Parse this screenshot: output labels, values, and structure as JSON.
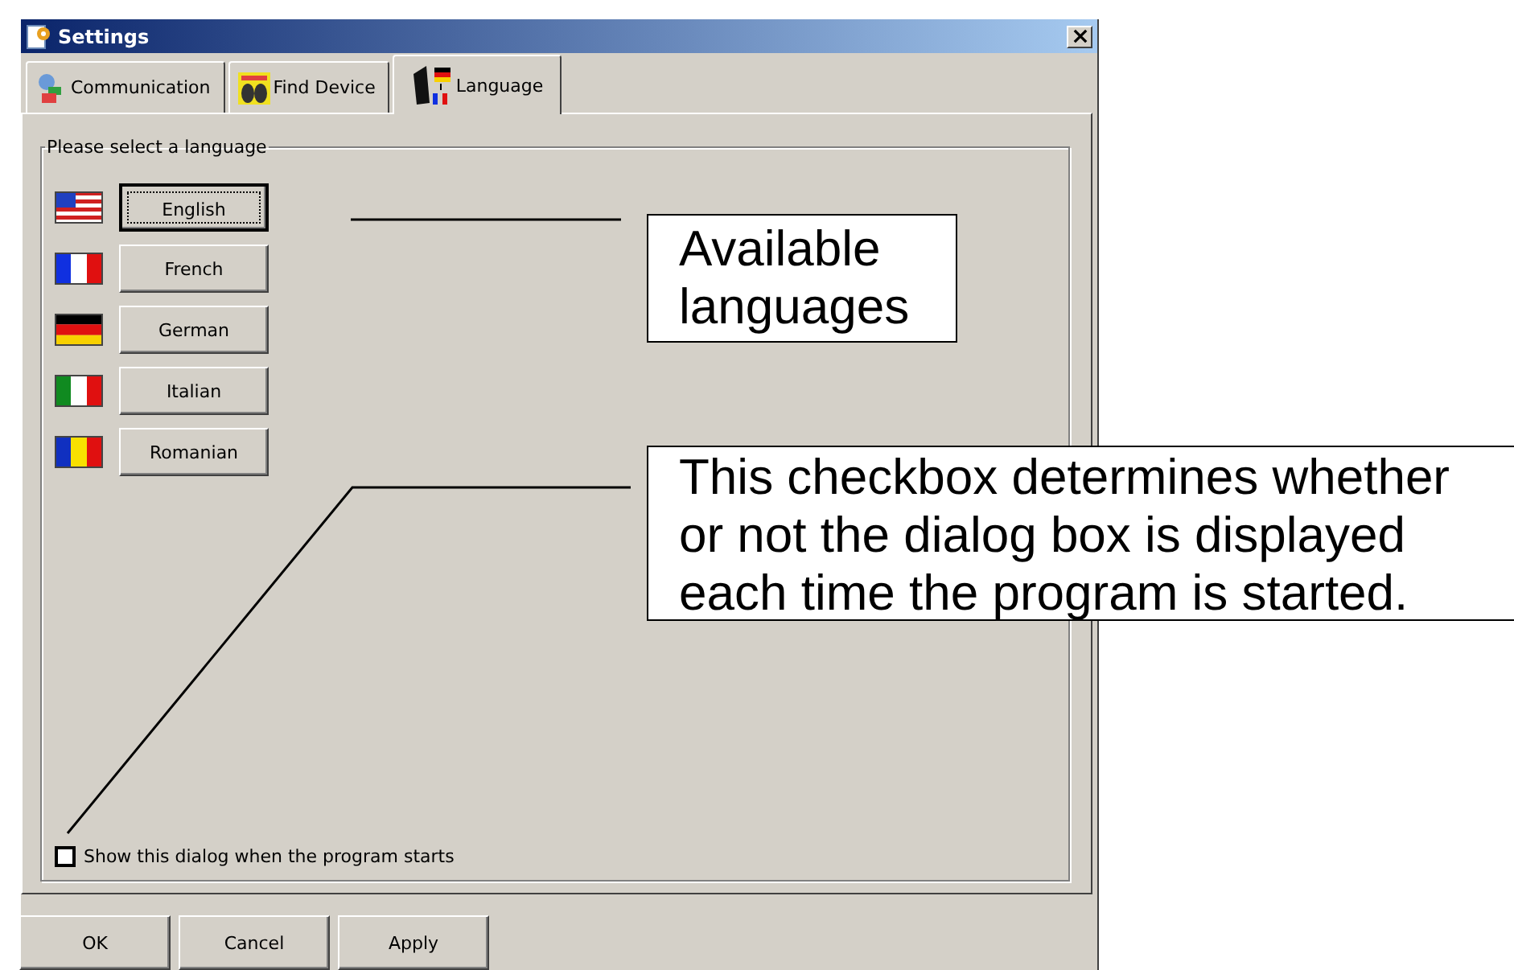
{
  "window": {
    "title": "Settings"
  },
  "tabs": [
    {
      "label": "Communication",
      "selected": false
    },
    {
      "label": "Find Device",
      "selected": false
    },
    {
      "label": "Language",
      "selected": true
    }
  ],
  "group": {
    "title": "Please select a language"
  },
  "languages": [
    {
      "label": "English",
      "focused": true
    },
    {
      "label": "French",
      "focused": false
    },
    {
      "label": "German",
      "focused": false
    },
    {
      "label": "Italian",
      "focused": false
    },
    {
      "label": "Romanian",
      "focused": false
    }
  ],
  "checkbox": {
    "label": "Show this dialog when the program starts",
    "checked": false
  },
  "buttons": [
    "OK",
    "Cancel",
    "Apply"
  ],
  "callouts": [
    "Available languages",
    "This checkbox determines whether or not the dialog box is displayed each time the program is started."
  ]
}
